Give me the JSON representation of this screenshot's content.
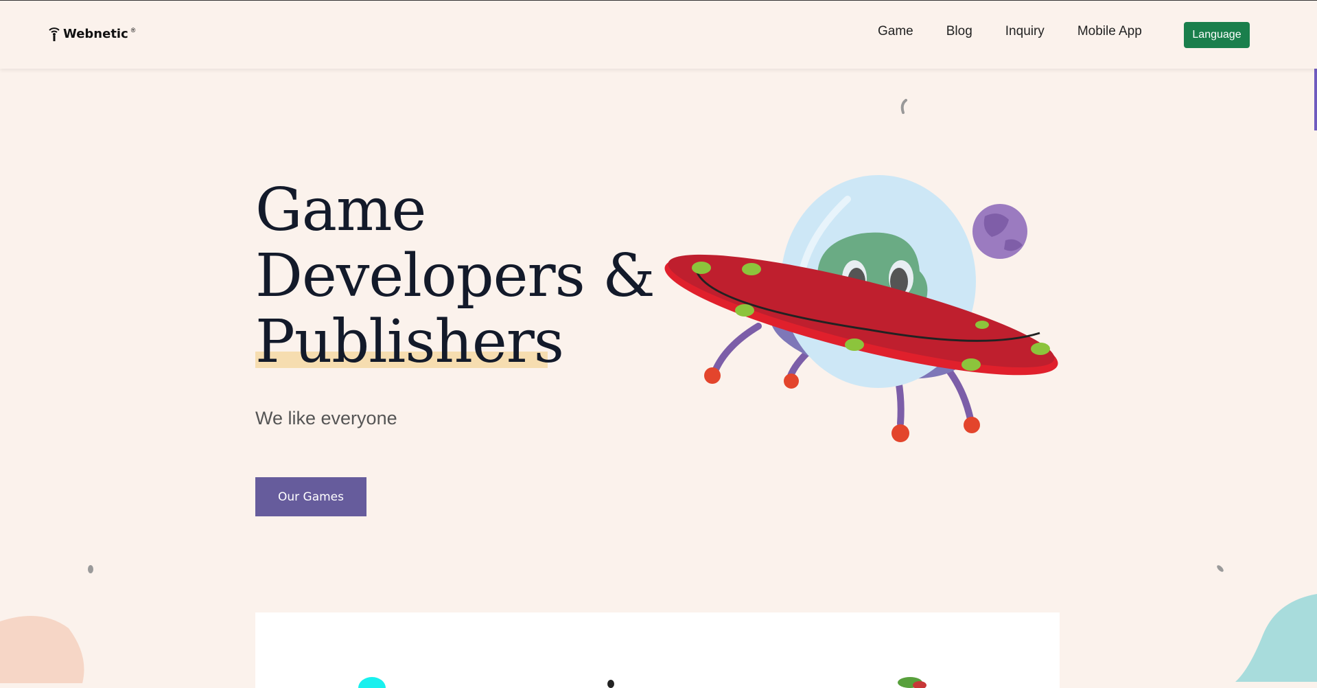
{
  "header": {
    "logo_text": "Webnetic",
    "logo_mark": "®",
    "nav": [
      {
        "label": "Game"
      },
      {
        "label": "Blog"
      },
      {
        "label": "Inquiry"
      },
      {
        "label": "Mobile App"
      }
    ],
    "language_button": "Language"
  },
  "hero": {
    "title_line1": "Game",
    "title_line2": "Developers &",
    "title_line3": "Publishers",
    "subtitle": "We like everyone",
    "cta_label": "Our Games"
  },
  "colors": {
    "background": "#fbf2ec",
    "accent_green": "#1a7f4c",
    "accent_purple": "#665c9c",
    "highlight": "#f6ddb0"
  },
  "icons": [
    "wifi-logo-icon",
    "ufo-alien-illustration",
    "planet-icon"
  ]
}
